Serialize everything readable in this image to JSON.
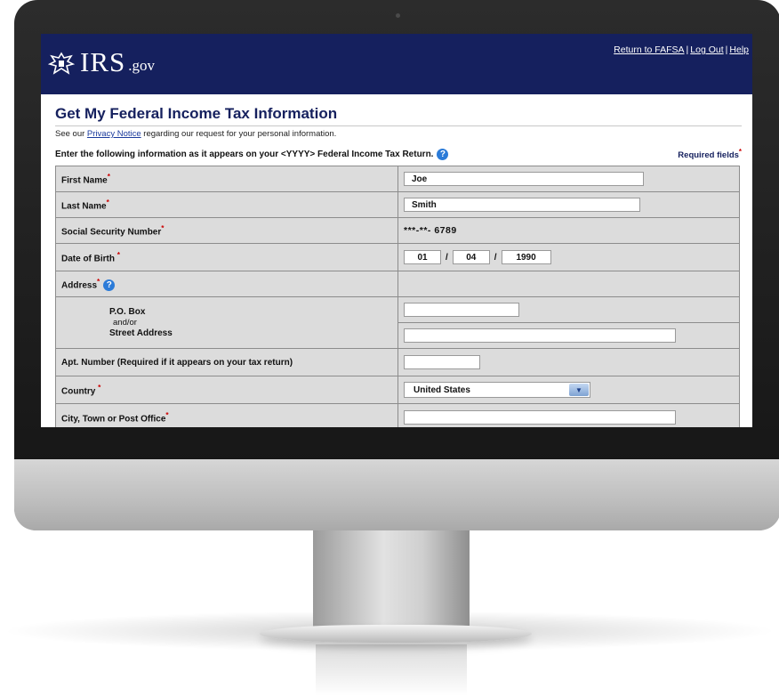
{
  "header": {
    "logo_text": "IRS",
    "logo_suffix": ".gov",
    "links": [
      "Return to FAFSA",
      "Log Out",
      "Help"
    ],
    "separator": "|"
  },
  "page": {
    "title": "Get My Federal Income Tax Information",
    "notice_prefix": "See our ",
    "notice_link": "Privacy Notice",
    "notice_suffix": " regarding our request for your personal information.",
    "instruction": "Enter the following information as it appears on your <YYYY> Federal Income Tax Return.",
    "required_fields_label": "Required fields",
    "required_marker": "*"
  },
  "form": {
    "first_name": {
      "label": "First Name",
      "value": "Joe"
    },
    "last_name": {
      "label": "Last Name",
      "value": "Smith"
    },
    "ssn": {
      "label": "Social Security Number",
      "value": "***-**- 6789"
    },
    "dob": {
      "label": "Date of Birth",
      "month": "01",
      "day": "04",
      "year": "1990",
      "separator": "/"
    },
    "address": {
      "label": "Address",
      "po_box_label": "P.O. Box",
      "andor_label": "and/or",
      "street_label": "Street Address",
      "po_box_value": "",
      "street_value": ""
    },
    "apt": {
      "label": "Apt. Number (Required if it appears on your tax return)",
      "value": ""
    },
    "country": {
      "label": "Country",
      "selected": "United States"
    },
    "city": {
      "label": "City, Town or Post Office",
      "value": ""
    }
  },
  "colors": {
    "header_bg": "#15205e",
    "required": "#cc0000",
    "help_icon": "#2b7bd8"
  }
}
